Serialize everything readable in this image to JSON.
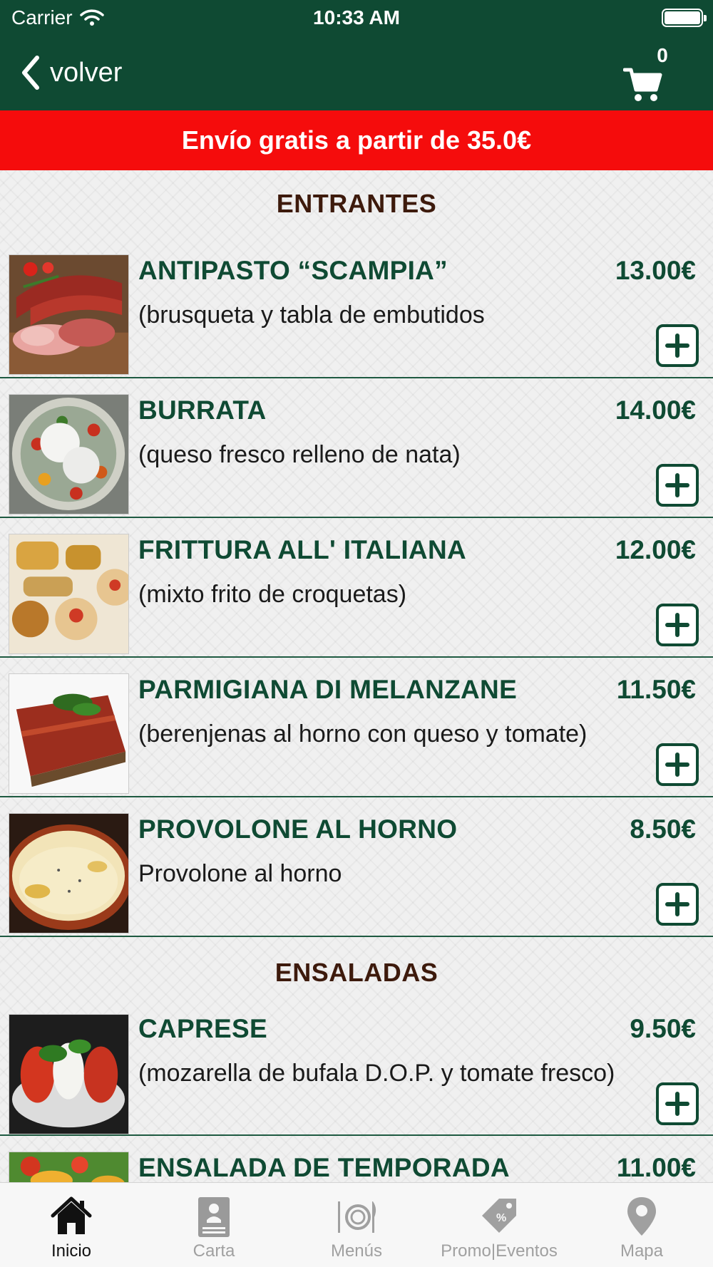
{
  "status_bar": {
    "carrier": "Carrier",
    "time": "10:33 AM"
  },
  "nav": {
    "back_label": "volver",
    "cart_count": "0"
  },
  "banner": {
    "text": "Envío gratis a partir de 35.0€"
  },
  "sections": [
    {
      "title": "ENTRANTES",
      "items": [
        {
          "name": "ANTIPASTO “SCAMPIA”",
          "price": "13.00€",
          "description": "(brusqueta y tabla de embutidos"
        },
        {
          "name": "BURRATA",
          "price": "14.00€",
          "description": "(queso fresco relleno de nata)"
        },
        {
          "name": "FRITTURA ALL' ITALIANA",
          "price": "12.00€",
          "description": "(mixto frito de croquetas)"
        },
        {
          "name": "PARMIGIANA DI MELANZANE",
          "price": "11.50€",
          "description": "(berenjenas al horno con queso y tomate)"
        },
        {
          "name": "PROVOLONE AL HORNO",
          "price": "8.50€",
          "description": "Provolone al horno"
        }
      ]
    },
    {
      "title": "ENSALADAS",
      "items": [
        {
          "name": "CAPRESE",
          "price": "9.50€",
          "description": "(mozarella de bufala D.O.P.  y tomate fresco)"
        },
        {
          "name": "ENSALADA DE TEMPORADA",
          "price": "11.00€",
          "description": ""
        }
      ]
    }
  ],
  "tabs": [
    {
      "label": "Inicio",
      "icon": "home-icon",
      "active": true
    },
    {
      "label": "Carta",
      "icon": "menu-card-icon",
      "active": false
    },
    {
      "label": "Menús",
      "icon": "plate-cutlery-icon",
      "active": false
    },
    {
      "label": "Promo|Eventos",
      "icon": "price-tag-icon",
      "active": false
    },
    {
      "label": "Mapa",
      "icon": "map-pin-icon",
      "active": false
    }
  ],
  "colors": {
    "header": "#0f4a33",
    "banner": "#f50c0c",
    "section_title": "#3d1a0c",
    "item_text": "#0f4a33",
    "tab_active": "#111111",
    "tab_inactive": "#a0a0a0"
  }
}
